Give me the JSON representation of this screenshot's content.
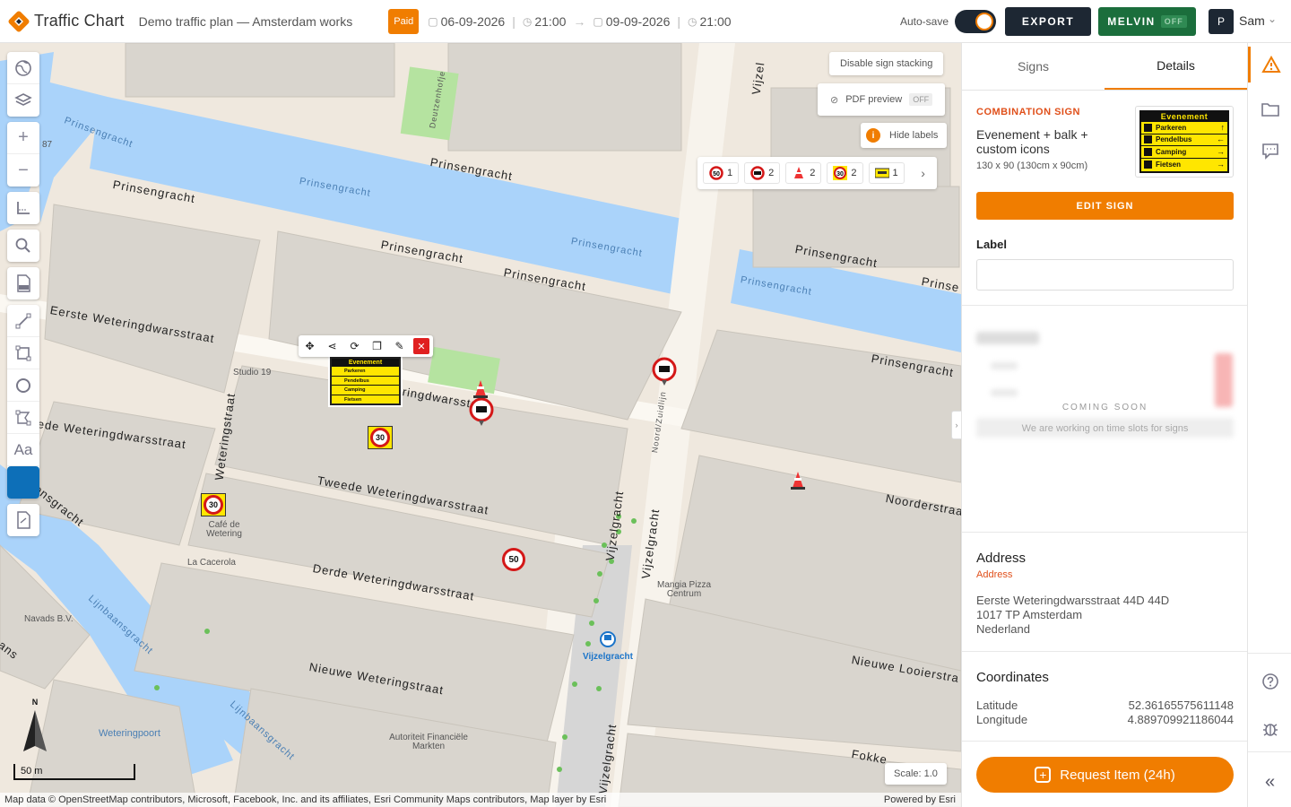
{
  "app": {
    "name": "Traffic Chart",
    "plan_title": "Demo traffic plan — Amsterdam works"
  },
  "header": {
    "paid": "Paid",
    "start_date": "06-09-2026",
    "start_time": "21:00",
    "end_date": "09-09-2026",
    "end_time": "21:00",
    "autosave_label": "Auto-save",
    "export_label": "EXPORT",
    "melvin_label": "MELVIN",
    "melvin_state": "OFF",
    "user_initial": "P",
    "user_name": "Sam"
  },
  "map": {
    "buttons": {
      "disable_stacking": "Disable sign stacking",
      "pdf_preview": "PDF preview",
      "pdf_state": "OFF",
      "hide_labels": "Hide labels"
    },
    "sign_counts": [
      {
        "icon": "speed-50-icon",
        "count": "1"
      },
      {
        "icon": "no-entry-icon",
        "count": "2"
      },
      {
        "icon": "traffic-cone-icon",
        "count": "2"
      },
      {
        "icon": "speed-30-icon",
        "count": "2"
      },
      {
        "icon": "barrier-sign-icon",
        "count": "1"
      }
    ],
    "selected_sign": {
      "header": "Evenement",
      "rows": [
        "Parkeren",
        "Pendelbus",
        "Camping",
        "Fietsen"
      ]
    },
    "speed_labels": {
      "s30": "30",
      "s50": "50"
    },
    "streets": {
      "prinsengracht": "Prinsengracht",
      "eerste": "Eerste Weteringdwarsstraat",
      "tweede": "Tweede Weteringdwarsstraat",
      "derde": "Derde Weteringdwarsstraat",
      "nieuwe": "Nieuwe Weteringstraat",
      "weteringstraat": "Weteringstraat",
      "vijzelgracht": "Vijzelgracht",
      "vijzel": "Vijzel",
      "noorderstraat": "Noorderstraa",
      "nieuwe_looiers": "Nieuwe Looierstra",
      "ringdwarsstr": "ringdwarsstr",
      "prinse": "Prinse",
      "lijnbaansgracht": "Lijnbaansgracht",
      "onsgracht": "onsgracht",
      "ede_wetering": "ede Weteringdwarsstraat",
      "fokke": "Fokke",
      "ans": "ans",
      "weteringpoort": "Weteringpoort",
      "deutzenhofje": "Deutzenhofje",
      "noorddijkzijde": "Noord/Zuidlijn",
      "nr87": "87",
      "cht": "cht"
    },
    "pois": {
      "studio": "Studio 19",
      "cafe": "Café de Wetering",
      "cacerola": "La Cacerola",
      "navads": "Navads B.V.",
      "mangia": "Mangia Pizza Centrum",
      "autoriteit": "Autoriteit Financiële Markten",
      "vijzel_station": "Vijzelgracht"
    },
    "compass_n": "N",
    "scale_text": "50 m",
    "scale_badge": "Scale: 1.0",
    "attribution": "Map data © OpenStreetMap contributors, Microsoft, Facebook, Inc. and its affiliates, Esri Community Maps contributors, Map layer by Esri",
    "powered": "Powered by Esri"
  },
  "panel": {
    "tabs": [
      "Signs",
      "Details"
    ],
    "combo_label": "COMBINATION SIGN",
    "combo_name": "Evenement + balk + custom icons",
    "combo_size": "130 x 90 (130cm x 90cm)",
    "edit_sign": "EDIT SIGN",
    "label_title": "Label",
    "label_value": "",
    "coming_soon_title": "COMING SOON",
    "coming_soon_text": "We are working on time slots for signs",
    "address_title": "Address",
    "address_sub": "Address",
    "address_line1": "Eerste Weteringdwarsstraat 44D 44D",
    "address_line2": "1017 TP Amsterdam",
    "address_line3": "Nederland",
    "coords_title": "Coordinates",
    "latitude_label": "Latitude",
    "latitude_value": "52.36165575611148",
    "longitude_label": "Longitude",
    "longitude_value": "4.889709921186044",
    "request_btn": "Request Item (24h)"
  },
  "colors": {
    "accent": "#f07d00",
    "dark": "#1d2733",
    "melvin": "#1b6e3c",
    "water": "#aad3fa",
    "land": "#efe8de"
  }
}
